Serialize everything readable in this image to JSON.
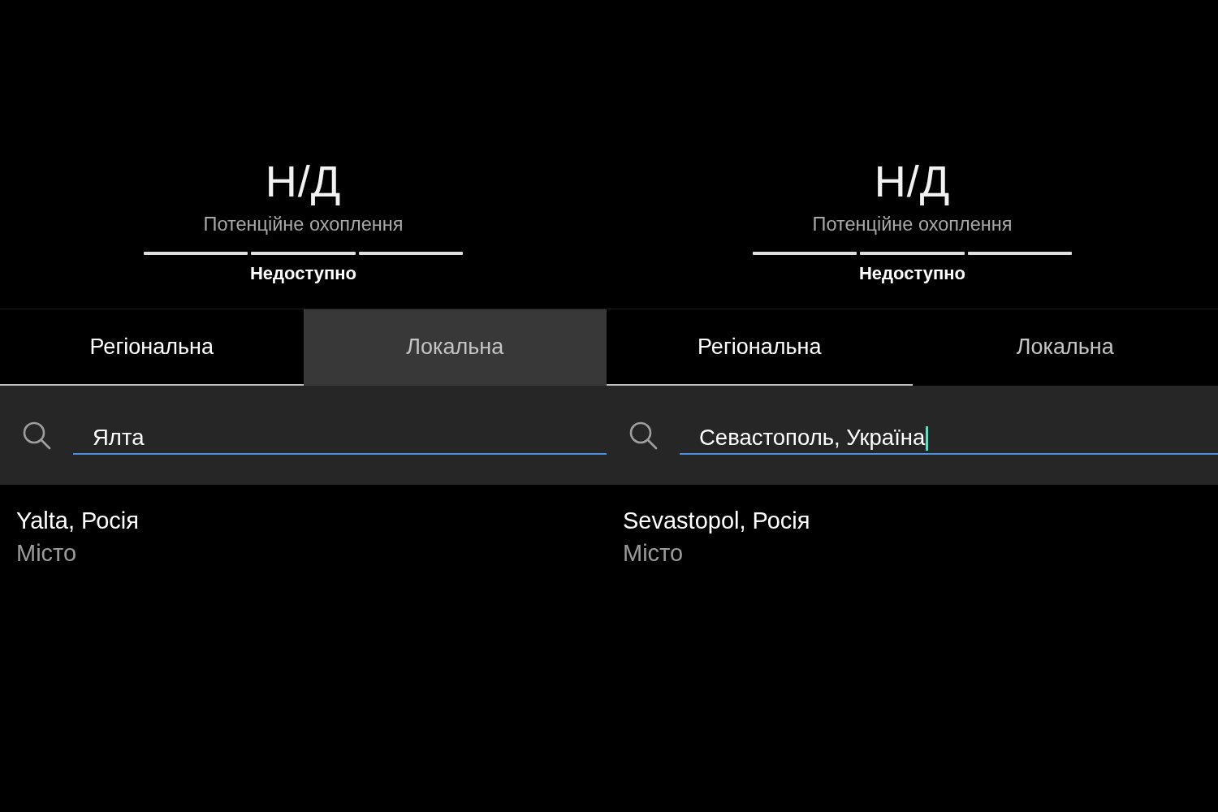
{
  "panels": [
    {
      "coverage": {
        "value": "Н/Д",
        "label": "Потенційне охоплення",
        "status": "Недоступно"
      },
      "tabs": [
        {
          "label": "Регіональна",
          "selected": true,
          "pressed": false
        },
        {
          "label": "Локальна",
          "selected": false,
          "pressed": true
        }
      ],
      "search": {
        "value": "Ялта",
        "focused": false
      },
      "results": [
        {
          "title": "Yalta, Росія",
          "subtitle": "Місто"
        }
      ]
    },
    {
      "coverage": {
        "value": "Н/Д",
        "label": "Потенційне охоплення",
        "status": "Недоступно"
      },
      "tabs": [
        {
          "label": "Регіональна",
          "selected": true,
          "pressed": false
        },
        {
          "label": "Локальна",
          "selected": false,
          "pressed": false
        }
      ],
      "search": {
        "value": "Севастополь, Україна",
        "focused": true
      },
      "results": [
        {
          "title": "Sevastopol, Росія",
          "subtitle": "Місто"
        }
      ]
    }
  ]
}
